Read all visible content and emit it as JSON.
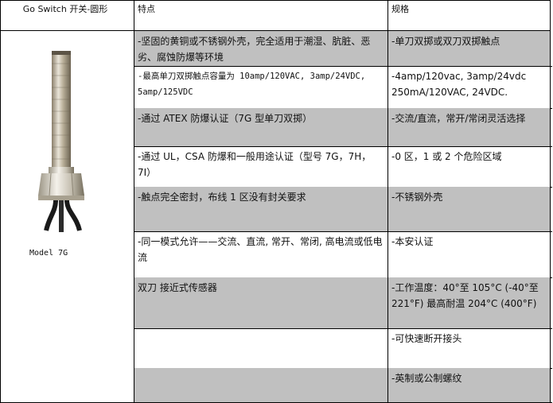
{
  "header": {
    "col1": "Go Switch 开关-圆形",
    "col2": "特点",
    "col3": "规格"
  },
  "product": {
    "model_label": "Model 7G"
  },
  "rows": [
    {
      "feature": "-坚固的黄铜或不锈钢外壳，完全适用于潮湿、肮脏、恶劣、腐蚀防爆等环境",
      "spec": "-单刀双掷或双刀双掷触点",
      "shaded": true
    },
    {
      "feature": "-最高单刀双掷触点容量为 10amp/120VAC, 3amp/24VDC, 5amp/125VDC",
      "spec": "-4amp/120vac,        3amp/24vdc 250mA/120VAC, 24VDC.",
      "shaded": false
    },
    {
      "feature": "-通过 ATEX 防爆认证（7G 型单刀双掷）",
      "spec": "-交流/直流，常开/常闭灵活选择",
      "shaded": true
    },
    {
      "feature": "-通过 UL，CSA 防爆和一般用途认证（型号 7G，7H，7I）",
      "spec": "-0 区，1 或 2 个危险区域",
      "shaded": false
    },
    {
      "feature": "-触点完全密封，布线 1 区没有封关要求",
      "spec": "-不锈钢外壳",
      "shaded": true
    },
    {
      "feature": "-同一模式允许——交流、直流, 常开、常闭, 高电流或低电流",
      "spec": "-本安认证",
      "shaded": false
    },
    {
      "feature": "双刀 接近式传感器",
      "spec": "-工作温度：40°至 105°C (-40°至 221°F) 最高耐温 204°C (400°F)",
      "shaded": true
    },
    {
      "feature": "",
      "spec": "-可快速断开接头",
      "shaded": false
    },
    {
      "feature": "",
      "spec": "-英制或公制螺纹",
      "shaded": true
    }
  ]
}
